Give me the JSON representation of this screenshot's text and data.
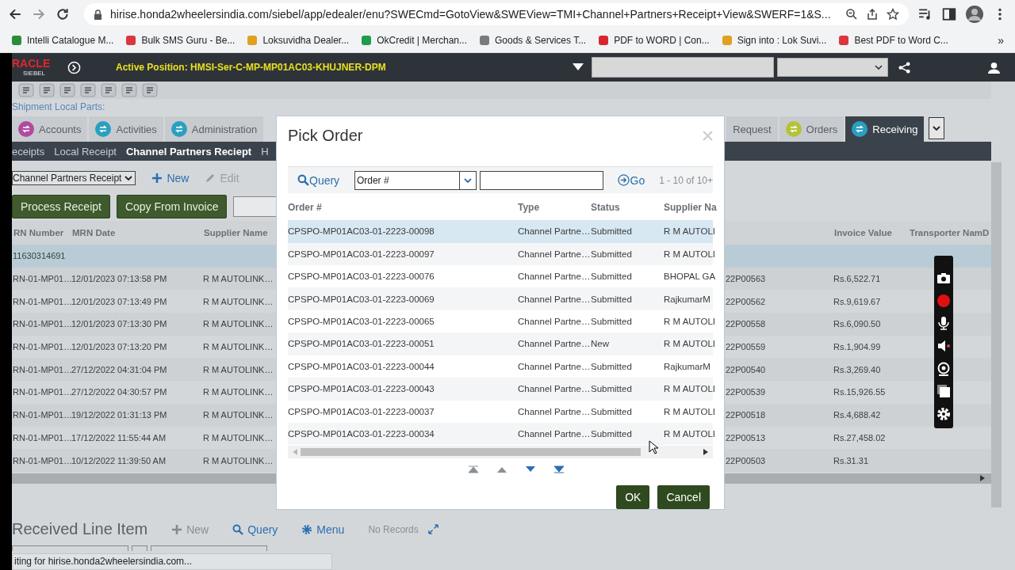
{
  "browser": {
    "url": "hirise.honda2wheelersindia.com/siebel/app/edealer/enu?SWECmd=GotoView&SWEView=TMI+Channel+Partners+Receipt+View&SWERF=1&S...",
    "bookmarks": [
      {
        "label": "Intelli Catalogue M...",
        "color": "#2e8b3a"
      },
      {
        "label": "Bulk SMS Guru - Be...",
        "color": "#d9363e"
      },
      {
        "label": "Loksuvidha Dealer...",
        "color": "#e0a020"
      },
      {
        "label": "OkCredit | Merchan...",
        "color": "#1f9d4a"
      },
      {
        "label": "Goods & Services T...",
        "color": "#7a7a7a"
      },
      {
        "label": "PDF to WORD | Con...",
        "color": "#d9262e"
      },
      {
        "label": "Sign into : Lok Suvi...",
        "color": "#e0a020"
      },
      {
        "label": "Best PDF to Word C...",
        "color": "#d9363e"
      }
    ],
    "more": "»"
  },
  "header": {
    "logo": "RACLE",
    "logo_sub": "SIEBEL",
    "active_position": "Active Position: HMSI-Ser-C-MP-MP01AC03-KHUJNER-DPM"
  },
  "breadcrumb": "Shipment Local Parts:",
  "tabs": [
    {
      "label": "Accounts",
      "selected": false,
      "color": "#b04aa0"
    },
    {
      "label": "Activities",
      "selected": false,
      "color": "#2a9fc0"
    },
    {
      "label": "Administration",
      "selected": false,
      "color": "#2a9fc0"
    },
    {
      "label": "Request",
      "selected": false
    },
    {
      "label": "Orders",
      "selected": false,
      "color": "#b5c23a"
    },
    {
      "label": "Receiving",
      "selected": true,
      "color": "#2a9fc0"
    }
  ],
  "subtabs": [
    {
      "label": "eceipts",
      "selected": false
    },
    {
      "label": "Local Receipt",
      "selected": false
    },
    {
      "label": "Channel Partners Reciept",
      "selected": true
    },
    {
      "label": "H",
      "selected": false
    }
  ],
  "actions": {
    "view_select": "Channel Partners Receipt",
    "new": "New",
    "edit": "Edit",
    "edit_disabled": true
  },
  "buttons": [
    "Process Receipt",
    "Copy From Invoice"
  ],
  "table": {
    "headers_left": [
      "RN Number",
      "MRN Date",
      "Supplier Name"
    ],
    "headers_right": [
      "Invoice Value",
      "Transporter Nam",
      "D"
    ],
    "rows": [
      {
        "selected": true,
        "cells": [
          "11630314691"
        ]
      },
      {
        "selected": false,
        "cells": [
          "RN-01-MP01…",
          "12/01/2023 07:13:58 PM",
          "R M AUTOLINK…",
          "22P00563",
          "Rs.6,522.71"
        ]
      },
      {
        "selected": false,
        "cells": [
          "RN-01-MP01…",
          "12/01/2023 07:13:49 PM",
          "R M AUTOLINK…",
          "22P00562",
          "Rs.9,619.67"
        ]
      },
      {
        "selected": false,
        "cells": [
          "RN-01-MP01…",
          "12/01/2023 07:13:30 PM",
          "R M AUTOLINK…",
          "22P00558",
          "Rs.6,090.50"
        ]
      },
      {
        "selected": false,
        "cells": [
          "RN-01-MP01…",
          "12/01/2023 07:13:20 PM",
          "R M AUTOLINK…",
          "22P00559",
          "Rs.1,904.99"
        ]
      },
      {
        "selected": false,
        "cells": [
          "RN-01-MP01…",
          "27/12/2022 04:31:04 PM",
          "R M AUTOLINK…",
          "22P00540",
          "Rs.3,269.40"
        ]
      },
      {
        "selected": false,
        "cells": [
          "RN-01-MP01…",
          "27/12/2022 04:30:57 PM",
          "R M AUTOLINK…",
          "22P00539",
          "Rs.15,926.55"
        ]
      },
      {
        "selected": false,
        "cells": [
          "RN-01-MP01…",
          "19/12/2022 01:31:13 PM",
          "R M AUTOLINK…",
          "22P00518",
          "Rs.4,688.42"
        ]
      },
      {
        "selected": false,
        "cells": [
          "RN-01-MP01…",
          "17/12/2022 11:55:44 AM",
          "R M AUTOLINK…",
          "22P00513",
          "Rs.27,458.02"
        ]
      },
      {
        "selected": false,
        "cells": [
          "RN-01-MP01…",
          "10/12/2022 11:39:50 AM",
          "R M AUTOLINK…",
          "22P00503",
          "Rs.31.31"
        ]
      }
    ]
  },
  "line_items": {
    "title": "Received Line Item",
    "new": "New",
    "query": "Query",
    "menu": "Menu",
    "count": "No Records"
  },
  "status_bar": "iting for hirise.honda2wheelersindia.com...",
  "dialog": {
    "title": "Pick Order",
    "query": "Query",
    "field_select": "Order #",
    "go": "Go",
    "range": "1 - 10 of 10+",
    "columns": [
      "Order #",
      "Type",
      "Status",
      "Supplier Na"
    ],
    "rows": [
      {
        "selected": true,
        "cells": [
          "CPSPO-MP01AC03-01-2223-00098",
          "Channel Partne…",
          "Submitted",
          "R M AUTOLI"
        ]
      },
      {
        "selected": false,
        "cells": [
          "CPSPO-MP01AC03-01-2223-00097",
          "Channel Partne…",
          "Submitted",
          "R M AUTOLI"
        ]
      },
      {
        "selected": false,
        "cells": [
          "CPSPO-MP01AC03-01-2223-00076",
          "Channel Partne…",
          "Submitted",
          "BHOPAL GA"
        ]
      },
      {
        "selected": false,
        "cells": [
          "CPSPO-MP01AC03-01-2223-00069",
          "Channel Partne…",
          "Submitted",
          "RajkumarM"
        ]
      },
      {
        "selected": false,
        "cells": [
          "CPSPO-MP01AC03-01-2223-00065",
          "Channel Partne…",
          "Submitted",
          "R M AUTOLI"
        ]
      },
      {
        "selected": false,
        "cells": [
          "CPSPO-MP01AC03-01-2223-00051",
          "Channel Partne…",
          "New",
          "R M AUTOLI"
        ]
      },
      {
        "selected": false,
        "cells": [
          "CPSPO-MP01AC03-01-2223-00044",
          "Channel Partne…",
          "Submitted",
          "RajkumarM"
        ]
      },
      {
        "selected": false,
        "cells": [
          "CPSPO-MP01AC03-01-2223-00043",
          "Channel Partne…",
          "Submitted",
          "R M AUTOLI"
        ]
      },
      {
        "selected": false,
        "cells": [
          "CPSPO-MP01AC03-01-2223-00037",
          "Channel Partne…",
          "Submitted",
          "R M AUTOLI"
        ]
      },
      {
        "selected": false,
        "cells": [
          "CPSPO-MP01AC03-01-2223-00034",
          "Channel Partne…",
          "Submitted",
          "R M AUTOLI"
        ]
      }
    ],
    "ok": "OK",
    "cancel": "Cancel"
  }
}
